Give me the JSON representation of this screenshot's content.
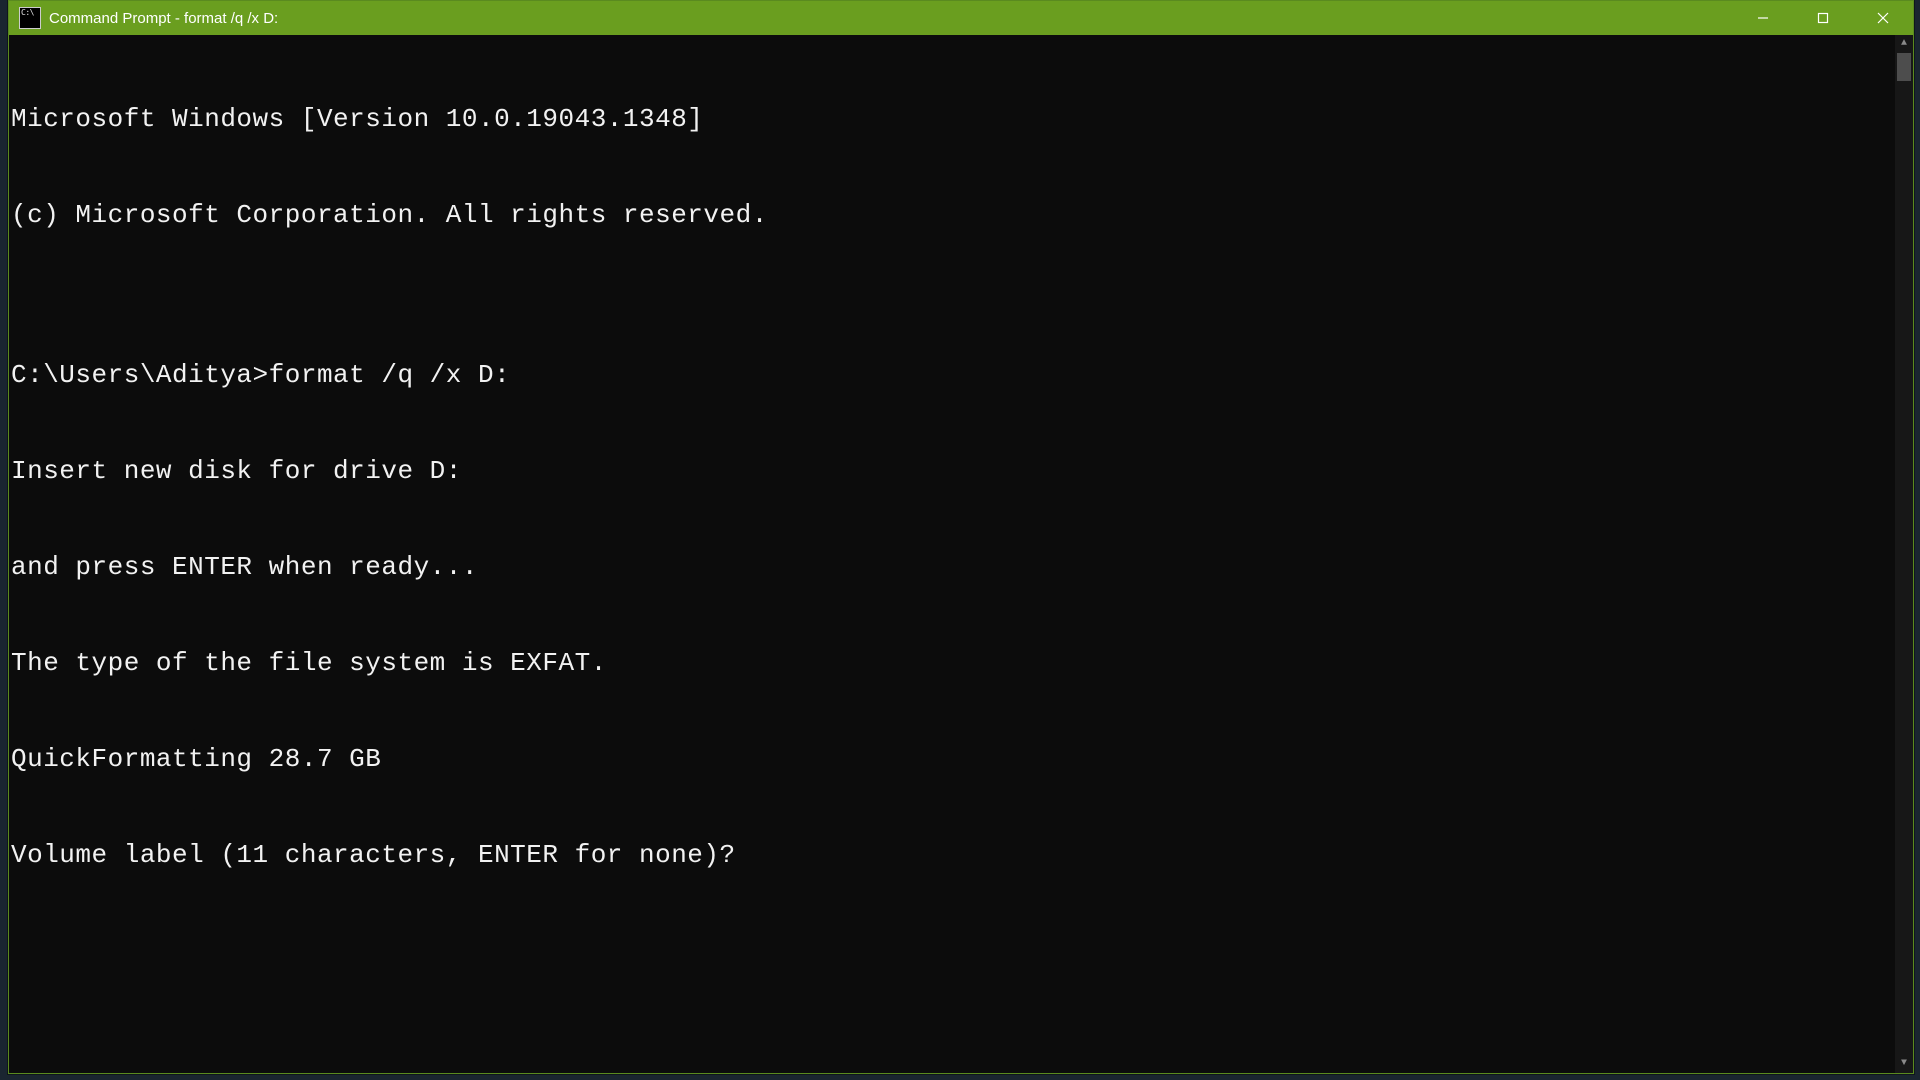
{
  "window": {
    "title": "Command Prompt - format  /q /x D:"
  },
  "terminal": {
    "lines": [
      "Microsoft Windows [Version 10.0.19043.1348]",
      "(c) Microsoft Corporation. All rights reserved.",
      "",
      "C:\\Users\\Aditya>format /q /x D:",
      "Insert new disk for drive D:",
      "and press ENTER when ready...",
      "The type of the file system is EXFAT.",
      "QuickFormatting 28.7 GB",
      "Volume label (11 characters, ENTER for none)?"
    ]
  },
  "colors": {
    "titlebar": "#6a9e1f",
    "terminal_bg": "#0c0c0c",
    "terminal_fg": "#f2f2f2"
  }
}
